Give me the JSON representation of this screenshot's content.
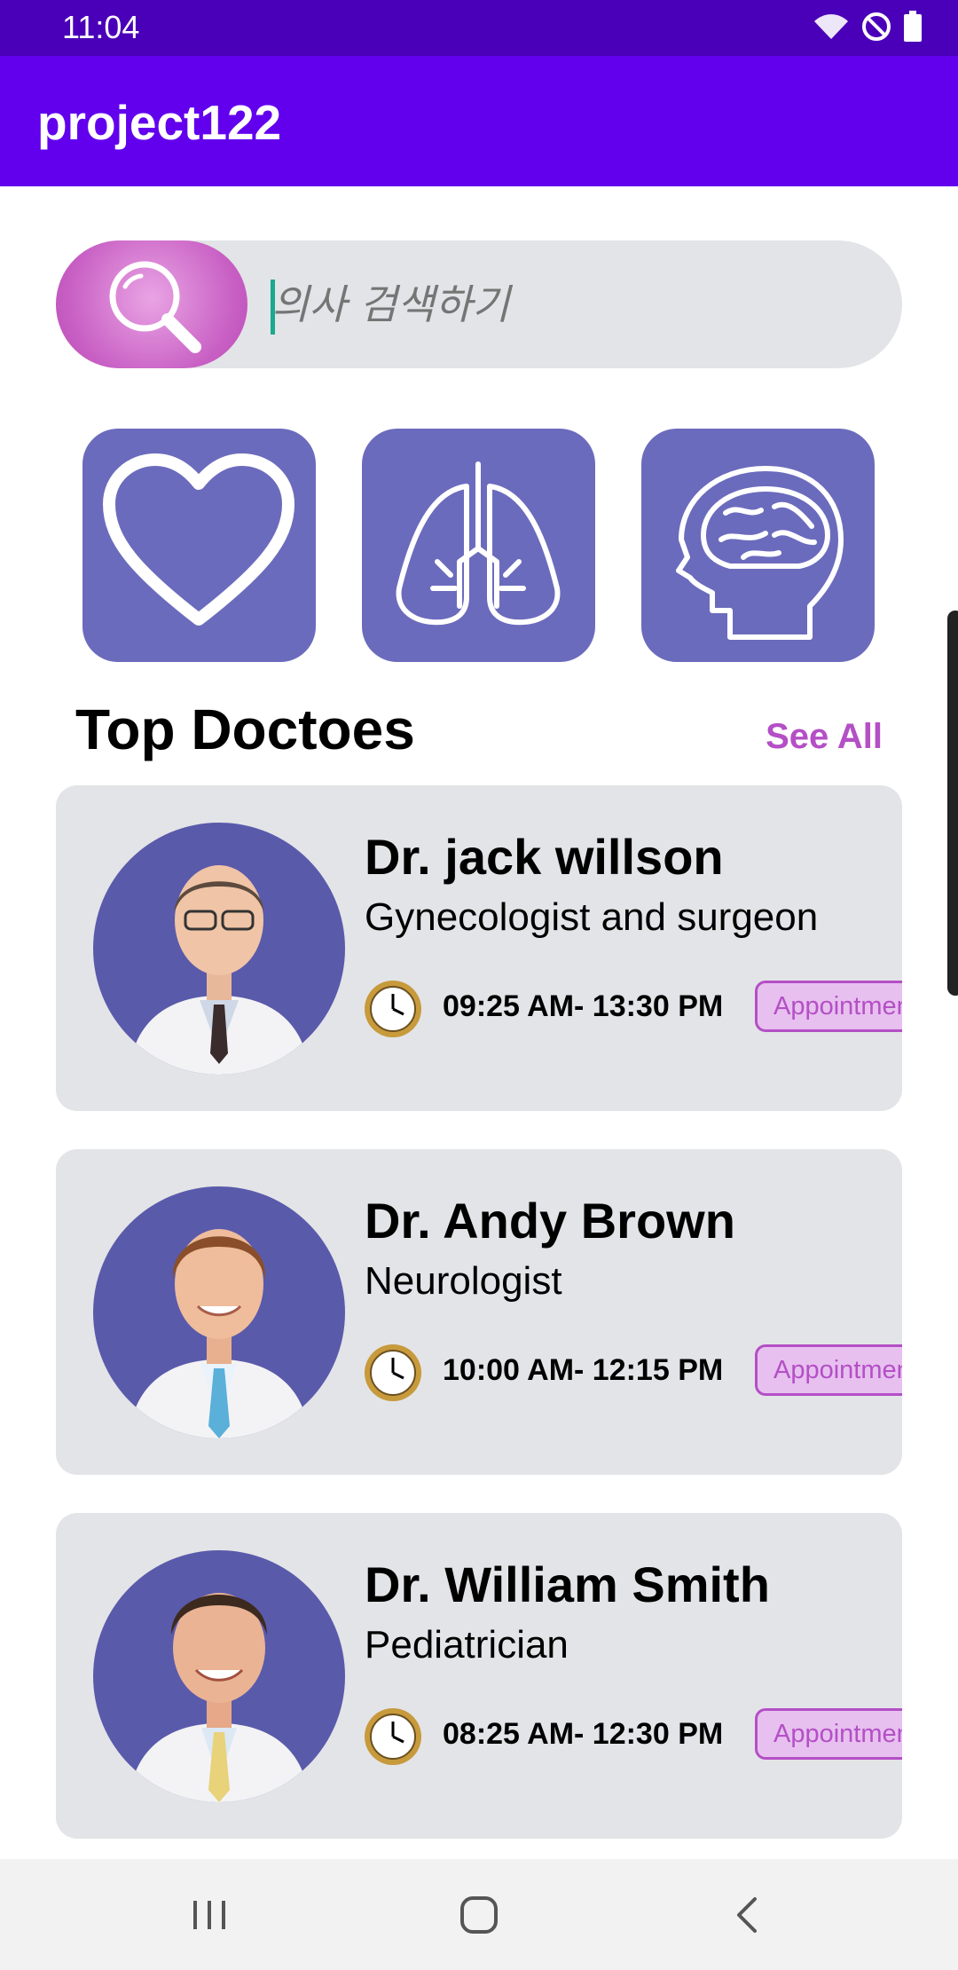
{
  "status_bar": {
    "time": "11:04"
  },
  "app_bar": {
    "title": "project122"
  },
  "search": {
    "placeholder": "의사 검색하기"
  },
  "categories": [
    {
      "icon": "heart-icon"
    },
    {
      "icon": "lungs-icon"
    },
    {
      "icon": "brain-icon"
    }
  ],
  "section": {
    "title": "Top Doctoes",
    "see_all": "See All"
  },
  "doctors": [
    {
      "name": "Dr. jack willson",
      "specialty": "Gynecologist and surgeon",
      "time": "09:25 AM- 13:30 PM",
      "button": "Appointment"
    },
    {
      "name": "Dr. Andy Brown",
      "specialty": "Neurologist",
      "time": "10:00 AM- 12:15 PM",
      "button": "Appointment"
    },
    {
      "name": "Dr. William Smith",
      "specialty": "Pediatrician",
      "time": "08:25 AM- 12:30 PM",
      "button": "Appointment"
    }
  ],
  "colors": {
    "status_bar": "#4a00b8",
    "app_bar": "#6200ee",
    "accent": "#b44fc6",
    "category_tile": "#6b6bbd",
    "card": "#e3e4e7"
  }
}
